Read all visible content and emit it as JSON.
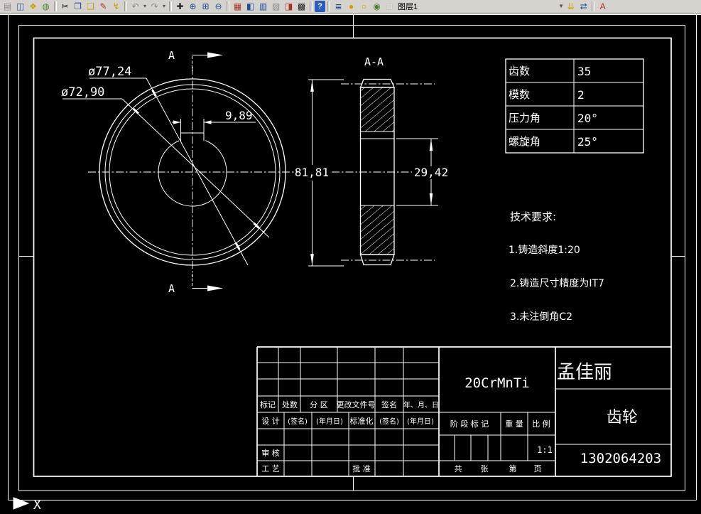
{
  "toolbar": {
    "layer_name": "图层1",
    "icons": [
      {
        "n": "plot-icon",
        "g": "▤"
      },
      {
        "n": "print-preview-icon",
        "g": "◫"
      },
      {
        "n": "publish-icon",
        "g": "❖"
      },
      {
        "n": "hyperlink-icon",
        "g": "◍"
      },
      {
        "n": "cut-icon",
        "g": "✂"
      },
      {
        "n": "copy-icon",
        "g": "❐"
      },
      {
        "n": "paste-icon",
        "g": "❑"
      },
      {
        "n": "matchprop-icon",
        "g": "✎"
      },
      {
        "n": "block-editor-icon",
        "g": "↯"
      },
      {
        "n": "undo-icon",
        "g": "↶"
      },
      {
        "n": "redo-icon",
        "g": "↷"
      },
      {
        "n": "pan-icon",
        "g": "✚"
      },
      {
        "n": "zoom-realtime-icon",
        "g": "⊕"
      },
      {
        "n": "zoom-window-icon",
        "g": "⊞"
      },
      {
        "n": "zoom-previous-icon",
        "g": "⊖"
      },
      {
        "n": "properties-icon",
        "g": "▦"
      },
      {
        "n": "designcenter-icon",
        "g": "◧"
      },
      {
        "n": "toolpalettes-icon",
        "g": "▥"
      },
      {
        "n": "sheetset-icon",
        "g": "▨"
      },
      {
        "n": "markup-icon",
        "g": "◨"
      },
      {
        "n": "qcalc-icon",
        "g": "▩"
      },
      {
        "n": "help-icon",
        "g": "?"
      },
      {
        "n": "layer-manager-icon",
        "g": "≣"
      },
      {
        "n": "layer-on-icon",
        "g": "●"
      },
      {
        "n": "layer-freeze-icon",
        "g": "○"
      },
      {
        "n": "layer-lock-icon",
        "g": "◉"
      },
      {
        "n": "layer-color-swatch",
        "g": "□"
      },
      {
        "n": "layer-dropdown-arrow",
        "g": "▼"
      },
      {
        "n": "layer-states-icon",
        "g": "⇊"
      },
      {
        "n": "layer-previous-icon",
        "g": "⇄"
      },
      {
        "n": "text-style-icon",
        "g": "A"
      }
    ]
  },
  "canvas": {
    "front_view": {
      "dim_tip": "ø77,24",
      "dim_root": "ø72,90",
      "dim_keyway": "9,89",
      "section_label_top": "A",
      "section_label_bottom": "A"
    },
    "section_view": {
      "label": "A-A",
      "dim_height": "81,81",
      "dim_bore": "29,42"
    },
    "param_table": {
      "rows": [
        {
          "label": "齿数",
          "value": "35"
        },
        {
          "label": "模数",
          "value": "2"
        },
        {
          "label": "压力角",
          "value": "20°"
        },
        {
          "label": "螺旋角",
          "value": "25°"
        }
      ]
    },
    "tech_req": {
      "title": "技术要求:",
      "items": [
        "1.铸造斜度1:20",
        "2.铸造尺寸精度为IT7",
        "3.未注倒角C2"
      ]
    },
    "title_block": {
      "material": "20CrMnTi",
      "designer": "孟佳丽",
      "part_name": "齿轮",
      "drawing_number": "1302064203",
      "scale_value": "1:1",
      "row_labels": [
        "标记",
        "处数",
        "分 区",
        "更改文件号",
        "签名",
        "年、月、日"
      ],
      "sign_labels": [
        "设 计",
        "(签名)",
        "(年月日)",
        "标准化",
        "(签名)",
        "(年月日)"
      ],
      "audit_label": "审 核",
      "process_label": "工 艺",
      "approve_label": "批 准",
      "stage_label": "阶 段 标 记",
      "weight_label": "重 量",
      "scale_label": "比 例",
      "sheet_labels": [
        "共",
        "张",
        "第",
        "页"
      ]
    },
    "ucs_axis_label": "X"
  }
}
